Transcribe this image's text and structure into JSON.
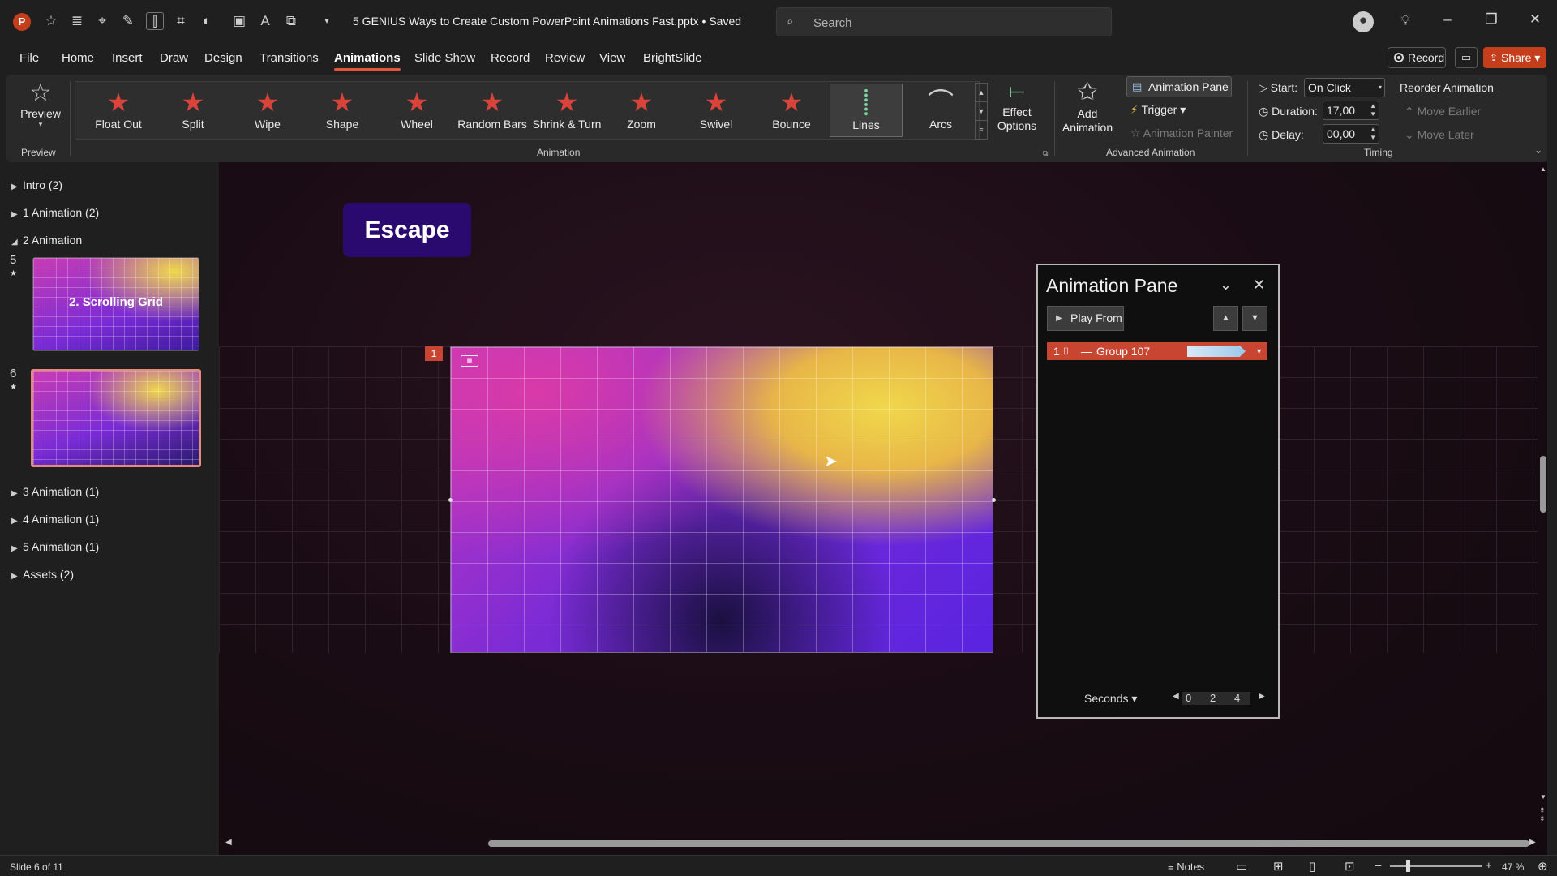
{
  "window": {
    "doc_title": "5 GENIUS Ways to Create Custom PowerPoint Animations Fast.pptx • Saved",
    "search_placeholder": "Search"
  },
  "menu": {
    "items": [
      "File",
      "Home",
      "Insert",
      "Draw",
      "Design",
      "Transitions",
      "Animations",
      "Slide Show",
      "Record",
      "Review",
      "View",
      "BrightSlide"
    ],
    "active": "Animations",
    "record": "Record",
    "share": "Share"
  },
  "ribbon": {
    "preview": {
      "label": "Preview",
      "group": "Preview"
    },
    "animation_group": "Animation",
    "animations": [
      "Float Out",
      "Split",
      "Wipe",
      "Shape",
      "Wheel",
      "Random Bars",
      "Shrink & Turn",
      "Zoom",
      "Swivel",
      "Bounce",
      "Lines",
      "Arcs"
    ],
    "selected_animation": "Lines",
    "effect_options": [
      "Effect",
      "Options"
    ],
    "advanced": {
      "group": "Advanced Animation",
      "add_animation": [
        "Add",
        "Animation"
      ],
      "animation_pane": "Animation Pane",
      "trigger": "Trigger",
      "animation_painter": "Animation Painter"
    },
    "timing": {
      "group": "Timing",
      "start_label": "Start:",
      "start_value": "On Click",
      "duration_label": "Duration:",
      "duration_value": "17,00",
      "delay_label": "Delay:",
      "delay_value": "00,00",
      "reorder": "Reorder Animation",
      "move_earlier": "Move Earlier",
      "move_later": "Move Later"
    }
  },
  "sidebar": {
    "sections_top": [
      "Intro (2)",
      "1 Animation (2)",
      "2 Animation"
    ],
    "slide5_num": "5",
    "slide5_title": "2. Scrolling Grid",
    "slide6_num": "6",
    "sections_bottom": [
      "3 Animation (1)",
      "4 Animation (1)",
      "5 Animation (1)",
      "Assets (2)"
    ]
  },
  "canvas": {
    "escape_label": "Escape",
    "anim_tag": "1"
  },
  "animation_pane": {
    "title": "Animation Pane",
    "play_from": "Play From",
    "item_number": "1",
    "item_name": "Group 107",
    "seconds": "Seconds",
    "ticks": [
      "0",
      "2",
      "4"
    ]
  },
  "status": {
    "slide_count": "Slide 6 of 11",
    "notes": "Notes",
    "zoom": "47 %"
  }
}
